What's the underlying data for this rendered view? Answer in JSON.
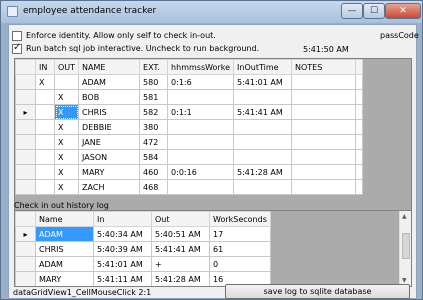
{
  "window": {
    "title": "employee attendance tracker",
    "minimize_glyph": "—",
    "maximize_glyph": "☐",
    "close_glyph": "✕"
  },
  "options": {
    "enforce_identity_label": "Enforce identity.  Allow only self to check in-out.",
    "enforce_identity_checked": false,
    "batch_job_label": "Run batch sql job interactive.  Uncheck to run background.",
    "batch_job_checked": true
  },
  "passcode_label": "passCode",
  "clock": "5:41:50 AM",
  "employees_grid": {
    "columns": [
      "IN",
      "OUT",
      "NAME",
      "EXT.",
      "hhmmssWorke",
      "InOutTime",
      "NOTES"
    ],
    "current_row_marker": "▸",
    "rows": [
      {
        "marker": "",
        "in": "X",
        "out": "",
        "name": "ADAM",
        "ext": "580",
        "worked": "0:1:6",
        "inout": "5:41:01 AM",
        "notes": ""
      },
      {
        "marker": "",
        "in": "",
        "out": "X",
        "name": "BOB",
        "ext": "581",
        "worked": "",
        "inout": "",
        "notes": ""
      },
      {
        "marker": "▸",
        "in": "",
        "out": "X",
        "name": "CHRIS",
        "ext": "582",
        "worked": "0:1:1",
        "inout": "5:41:41 AM",
        "notes": ""
      },
      {
        "marker": "",
        "in": "",
        "out": "X",
        "name": "DEBBIE",
        "ext": "380",
        "worked": "",
        "inout": "",
        "notes": ""
      },
      {
        "marker": "",
        "in": "",
        "out": "X",
        "name": "JANE",
        "ext": "472",
        "worked": "",
        "inout": "",
        "notes": ""
      },
      {
        "marker": "",
        "in": "",
        "out": "X",
        "name": "JASON",
        "ext": "584",
        "worked": "",
        "inout": "",
        "notes": ""
      },
      {
        "marker": "",
        "in": "",
        "out": "X",
        "name": "MARY",
        "ext": "460",
        "worked": "0:0:16",
        "inout": "5:41:28 AM",
        "notes": ""
      },
      {
        "marker": "",
        "in": "",
        "out": "X",
        "name": "ZACH",
        "ext": "468",
        "worked": "",
        "inout": "",
        "notes": ""
      }
    ]
  },
  "history": {
    "label": "Check in out history log",
    "columns": [
      "Name",
      "In",
      "Out",
      "WorkSeconds"
    ],
    "rows": [
      {
        "marker": "▸",
        "name": "ADAM",
        "in": "5:40:34 AM",
        "out": "5:40:51 AM",
        "seconds": "17"
      },
      {
        "marker": "",
        "name": "CHRIS",
        "in": "5:40:39 AM",
        "out": "5:41:41 AM",
        "seconds": "61"
      },
      {
        "marker": "",
        "name": "ADAM",
        "in": "5:41:01 AM",
        "out": "+",
        "seconds": "0"
      },
      {
        "marker": "",
        "name": "MARY",
        "in": "5:41:11 AM",
        "out": "5:41:28 AM",
        "seconds": "16"
      }
    ],
    "scroll_up_glyph": "▲",
    "scroll_down_glyph": "▼"
  },
  "status_text": "dataGridView1_CellMouseClick 2:1",
  "save_button_label": "save log to sqlite database"
}
